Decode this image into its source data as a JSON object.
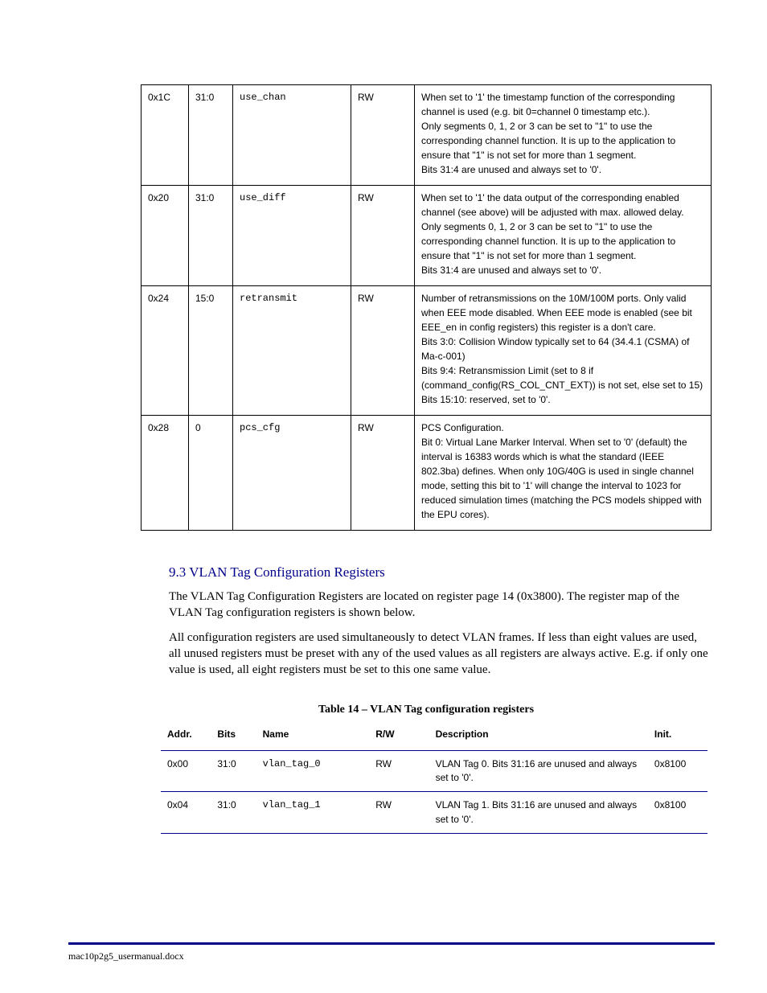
{
  "table1": {
    "rows": [
      {
        "addr": "0x1C",
        "bits": "31:0",
        "name": "use_chan",
        "rw": "RW",
        "desc": "When set to '1' the timestamp function of the corresponding channel is used (e.g. bit 0=channel 0 timestamp etc.).\nOnly segments 0, 1, 2 or 3 can be set to \"1\" to use the corresponding channel function. It is up to the application to ensure that \"1\" is not set for more than 1 segment.\nBits 31:4 are unused and always set to '0'."
      },
      {
        "addr": "0x20",
        "bits": "31:0",
        "name": "use_diff",
        "rw": "RW",
        "desc": "When set to '1' the data output of the corresponding enabled channel (see above) will be adjusted with max. allowed delay.\nOnly segments 0, 1, 2 or 3 can be set to \"1\" to use the corresponding channel function. It is up to the application to ensure that \"1\" is not set for more than 1 segment.\nBits 31:4 are unused and always set to '0'."
      },
      {
        "addr": "0x24",
        "bits": "15:0",
        "name": "retransmit",
        "rw": "RW",
        "desc": "Number of retransmissions on the 10M/100M ports. Only valid when EEE mode disabled. When EEE mode is enabled (see bit EEE_en in config registers) this register is a don't care.\nBits 3:0: Collision Window typically set to 64 (34.4.1 (CSMA) of Ma-c-001)\nBits 9:4: Retransmission Limit (set to 8 if (command_config(RS_COL_CNT_EXT)) is not set, else set to 15)\nBits 15:10: reserved, set to '0'."
      },
      {
        "addr": "0x28",
        "bits": "0",
        "name": "pcs_cfg",
        "rw": "RW",
        "desc": "PCS Configuration.\nBit 0: Virtual Lane Marker Interval. When set to '0' (default) the interval is 16383 words which is what the standard (IEEE 802.3ba) defines. When only 10G/40G is used in single channel mode, setting this bit to '1' will change the interval to 1023 for reduced simulation times (matching the PCS models shipped with the EPU cores)."
      }
    ]
  },
  "section": {
    "title": "9.3 VLAN Tag Configuration Registers",
    "para1": "The VLAN Tag Configuration Registers are located on register page 14 (0x3800). The register map of the VLAN Tag configuration registers is shown below.",
    "para2": "All configuration registers are used simultaneously to detect VLAN frames. If less than eight values are used, all unused registers must be preset with any of the used values as all registers are always active. E.g. if only one value is used, all eight registers must be set to this one same value."
  },
  "table2": {
    "title": "Table 14 – VLAN Tag configuration registers",
    "headers": [
      "Addr.",
      "Bits",
      "Name",
      "R/W",
      "Description",
      "Init."
    ],
    "rows": [
      {
        "addr": "0x00",
        "bits": "31:0",
        "name": "vlan_tag_0",
        "rw": "RW",
        "desc": "VLAN Tag 0. Bits 31:16 are unused and always set to '0'.",
        "init": "0x8100"
      },
      {
        "addr": "0x04",
        "bits": "31:0",
        "name": "vlan_tag_1",
        "rw": "RW",
        "desc": "VLAN Tag 1. Bits 31:16 are unused and always set to '0'.",
        "init": "0x8100"
      }
    ]
  },
  "footer": "mac10p2g5_usermanual.docx"
}
